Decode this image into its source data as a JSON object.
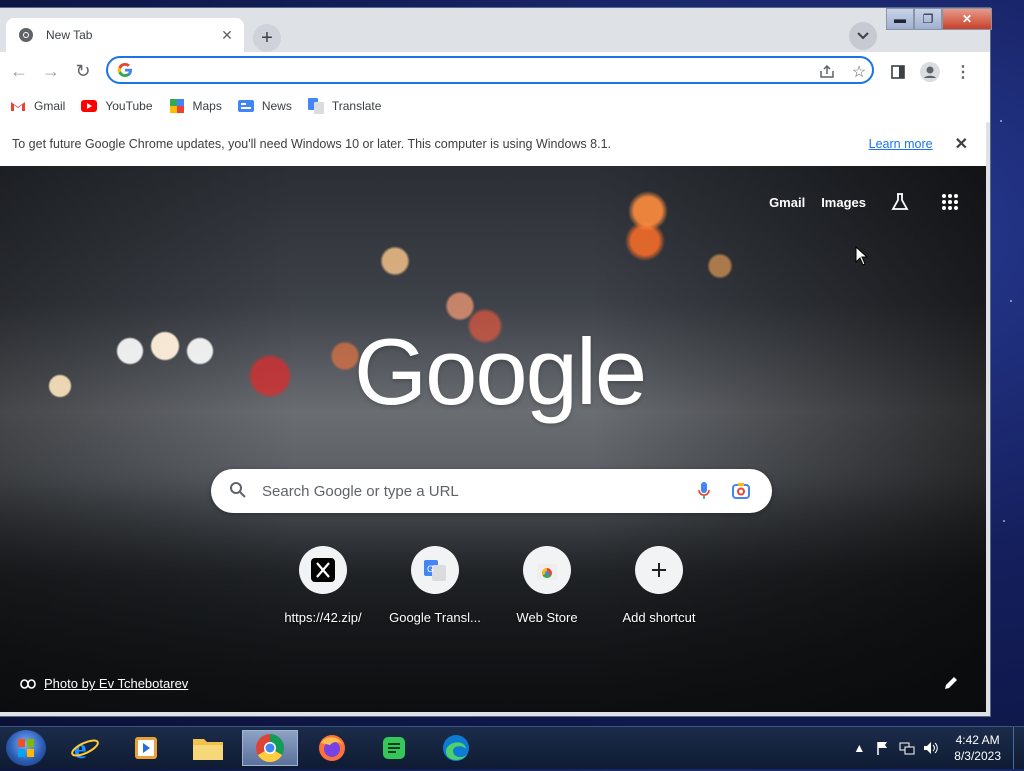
{
  "window": {
    "tab_title": "New Tab",
    "controls": {
      "minimize": "▬",
      "maximize": "❐",
      "close": "✕"
    }
  },
  "toolbar": {
    "omnibox_value": "",
    "omnibox_placeholder": ""
  },
  "bookmarks": [
    {
      "label": "Gmail",
      "icon": "gmail-icon"
    },
    {
      "label": "YouTube",
      "icon": "youtube-icon"
    },
    {
      "label": "Maps",
      "icon": "maps-icon"
    },
    {
      "label": "News",
      "icon": "news-icon"
    },
    {
      "label": "Translate",
      "icon": "translate-icon"
    }
  ],
  "infobar": {
    "message": "To get future Google Chrome updates, you'll need Windows 10 or later. This computer is using Windows 8.1.",
    "learn_more": "Learn more"
  },
  "ntp": {
    "top_links": {
      "gmail": "Gmail",
      "images": "Images"
    },
    "logo": "Google",
    "search_placeholder": "Search Google or type a URL",
    "shortcuts": [
      {
        "label": "https://42.zip/",
        "icon": "x-icon"
      },
      {
        "label": "Google Transl...",
        "icon": "google-translate-icon"
      },
      {
        "label": "Web Store",
        "icon": "chrome-web-store-icon"
      },
      {
        "label": "Add shortcut",
        "icon": "plus-icon"
      }
    ],
    "photo_credit": "Photo by Ev Tchebotarev"
  },
  "taskbar": {
    "apps": [
      "start-button",
      "internet-explorer",
      "windows-media-player",
      "file-explorer",
      "google-chrome",
      "firefox",
      "google-sheets",
      "microsoft-edge"
    ],
    "clock_time": "4:42 AM",
    "clock_date": "8/3/2023"
  },
  "colors": {
    "accent": "#1a73e8",
    "tab_strip": "#dee1e6",
    "taskbar": "#0f1b33"
  }
}
